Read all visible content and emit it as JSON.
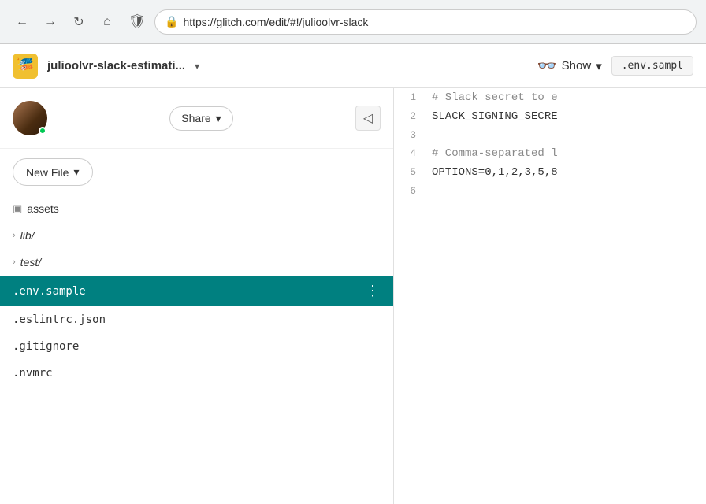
{
  "browser": {
    "url": "https://glitch.com/edit/#!/julioolvr-slack",
    "url_full": "https://glitch.com/edit/#!/julioolvr-slack"
  },
  "header": {
    "logo_emoji": "🎏",
    "title": "julioolvr-slack-estimati...",
    "dropdown_label": "▾",
    "show_label": "Show",
    "show_icon": "👓",
    "env_tab": ".env.sampl"
  },
  "sidebar": {
    "share_label": "Share",
    "new_file_label": "New File",
    "files": [
      {
        "type": "asset",
        "name": "assets",
        "icon": "▣"
      },
      {
        "type": "folder",
        "name": "lib/",
        "chevron": "›"
      },
      {
        "type": "folder",
        "name": "test/",
        "chevron": "›"
      },
      {
        "type": "file",
        "name": ".env.sample",
        "active": true,
        "more": "⋮"
      },
      {
        "type": "file",
        "name": ".eslintrc.json",
        "active": false
      },
      {
        "type": "file",
        "name": ".gitignore",
        "active": false
      },
      {
        "type": "file",
        "name": ".nvmrc",
        "active": false
      }
    ]
  },
  "code": {
    "lines": [
      {
        "num": "1",
        "text": "# Slack secret to e",
        "type": "comment"
      },
      {
        "num": "2",
        "text": "SLACK_SIGNING_SECRE",
        "type": "key"
      },
      {
        "num": "3",
        "text": "",
        "type": "normal"
      },
      {
        "num": "4",
        "text": "# Comma-separated l",
        "type": "comment"
      },
      {
        "num": "5",
        "text": "OPTIONS=0,1,2,3,5,8",
        "type": "key"
      },
      {
        "num": "6",
        "text": "",
        "type": "normal"
      }
    ]
  },
  "icons": {
    "back": "←",
    "forward": "→",
    "reload": "↻",
    "home": "⌂",
    "shield": "🛡",
    "lock": "🔒",
    "dropdown": "▾",
    "collapse": "◁",
    "chevron_right": "›"
  }
}
